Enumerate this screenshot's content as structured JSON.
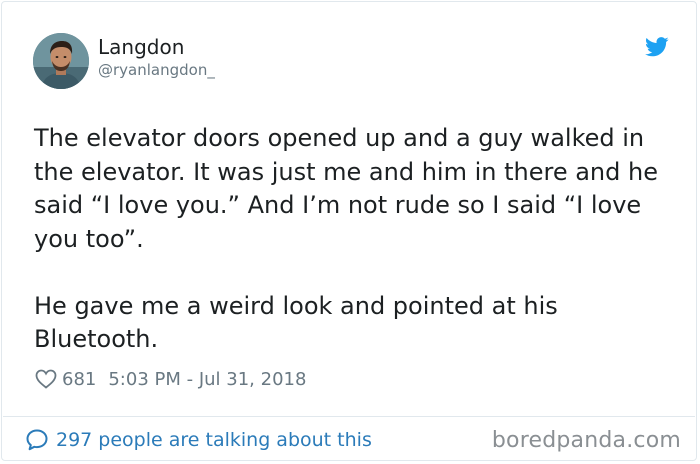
{
  "author": {
    "name": "Langdon",
    "handle": "@ryanlangdon_"
  },
  "icons": {
    "brand": "twitter-bird-icon",
    "like": "heart-icon",
    "replies": "speech-bubble-icon"
  },
  "tweet": {
    "paragraphs": [
      "The elevator doors opened up and a guy walked in the elevator. It was just me and him in there and he said “I love you.” And I’m not rude so I said “I love you too”.",
      "He gave me a weird look and pointed at his Bluetooth."
    ],
    "likes": "681",
    "timestamp": "5:03 PM - Jul 31, 2018"
  },
  "footer": {
    "talking_text": "297 people are talking about this",
    "watermark": "boredpanda.com"
  },
  "colors": {
    "twitter_blue": "#1da1f2",
    "link_blue": "#2b7bb9",
    "muted_gray": "#697882",
    "border": "#e1e8ed"
  }
}
